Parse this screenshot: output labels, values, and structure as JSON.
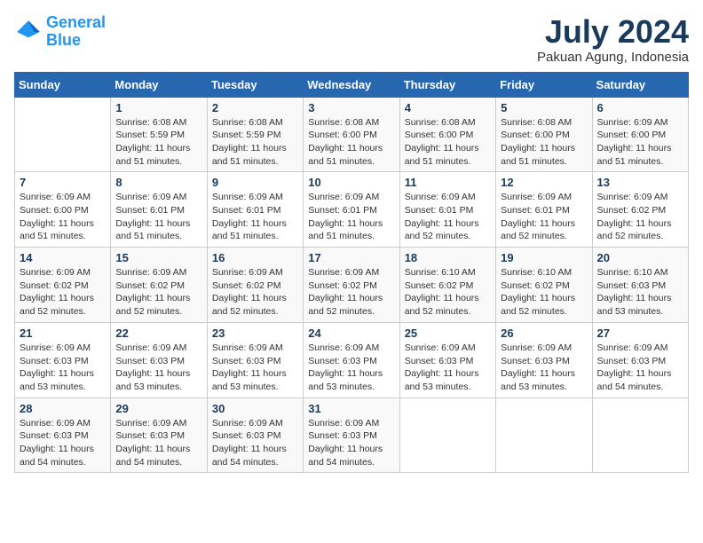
{
  "logo": {
    "text_general": "General",
    "text_blue": "Blue"
  },
  "title": {
    "month_year": "July 2024",
    "location": "Pakuan Agung, Indonesia"
  },
  "weekdays": [
    "Sunday",
    "Monday",
    "Tuesday",
    "Wednesday",
    "Thursday",
    "Friday",
    "Saturday"
  ],
  "days": [
    {
      "date": "",
      "info": ""
    },
    {
      "date": "1",
      "info": "Sunrise: 6:08 AM\nSunset: 5:59 PM\nDaylight: 11 hours\nand 51 minutes."
    },
    {
      "date": "2",
      "info": "Sunrise: 6:08 AM\nSunset: 5:59 PM\nDaylight: 11 hours\nand 51 minutes."
    },
    {
      "date": "3",
      "info": "Sunrise: 6:08 AM\nSunset: 6:00 PM\nDaylight: 11 hours\nand 51 minutes."
    },
    {
      "date": "4",
      "info": "Sunrise: 6:08 AM\nSunset: 6:00 PM\nDaylight: 11 hours\nand 51 minutes."
    },
    {
      "date": "5",
      "info": "Sunrise: 6:08 AM\nSunset: 6:00 PM\nDaylight: 11 hours\nand 51 minutes."
    },
    {
      "date": "6",
      "info": "Sunrise: 6:09 AM\nSunset: 6:00 PM\nDaylight: 11 hours\nand 51 minutes."
    },
    {
      "date": "7",
      "info": "Sunrise: 6:09 AM\nSunset: 6:00 PM\nDaylight: 11 hours\nand 51 minutes."
    },
    {
      "date": "8",
      "info": "Sunrise: 6:09 AM\nSunset: 6:01 PM\nDaylight: 11 hours\nand 51 minutes."
    },
    {
      "date": "9",
      "info": "Sunrise: 6:09 AM\nSunset: 6:01 PM\nDaylight: 11 hours\nand 51 minutes."
    },
    {
      "date": "10",
      "info": "Sunrise: 6:09 AM\nSunset: 6:01 PM\nDaylight: 11 hours\nand 51 minutes."
    },
    {
      "date": "11",
      "info": "Sunrise: 6:09 AM\nSunset: 6:01 PM\nDaylight: 11 hours\nand 52 minutes."
    },
    {
      "date": "12",
      "info": "Sunrise: 6:09 AM\nSunset: 6:01 PM\nDaylight: 11 hours\nand 52 minutes."
    },
    {
      "date": "13",
      "info": "Sunrise: 6:09 AM\nSunset: 6:02 PM\nDaylight: 11 hours\nand 52 minutes."
    },
    {
      "date": "14",
      "info": "Sunrise: 6:09 AM\nSunset: 6:02 PM\nDaylight: 11 hours\nand 52 minutes."
    },
    {
      "date": "15",
      "info": "Sunrise: 6:09 AM\nSunset: 6:02 PM\nDaylight: 11 hours\nand 52 minutes."
    },
    {
      "date": "16",
      "info": "Sunrise: 6:09 AM\nSunset: 6:02 PM\nDaylight: 11 hours\nand 52 minutes."
    },
    {
      "date": "17",
      "info": "Sunrise: 6:09 AM\nSunset: 6:02 PM\nDaylight: 11 hours\nand 52 minutes."
    },
    {
      "date": "18",
      "info": "Sunrise: 6:10 AM\nSunset: 6:02 PM\nDaylight: 11 hours\nand 52 minutes."
    },
    {
      "date": "19",
      "info": "Sunrise: 6:10 AM\nSunset: 6:02 PM\nDaylight: 11 hours\nand 52 minutes."
    },
    {
      "date": "20",
      "info": "Sunrise: 6:10 AM\nSunset: 6:03 PM\nDaylight: 11 hours\nand 53 minutes."
    },
    {
      "date": "21",
      "info": "Sunrise: 6:09 AM\nSunset: 6:03 PM\nDaylight: 11 hours\nand 53 minutes."
    },
    {
      "date": "22",
      "info": "Sunrise: 6:09 AM\nSunset: 6:03 PM\nDaylight: 11 hours\nand 53 minutes."
    },
    {
      "date": "23",
      "info": "Sunrise: 6:09 AM\nSunset: 6:03 PM\nDaylight: 11 hours\nand 53 minutes."
    },
    {
      "date": "24",
      "info": "Sunrise: 6:09 AM\nSunset: 6:03 PM\nDaylight: 11 hours\nand 53 minutes."
    },
    {
      "date": "25",
      "info": "Sunrise: 6:09 AM\nSunset: 6:03 PM\nDaylight: 11 hours\nand 53 minutes."
    },
    {
      "date": "26",
      "info": "Sunrise: 6:09 AM\nSunset: 6:03 PM\nDaylight: 11 hours\nand 53 minutes."
    },
    {
      "date": "27",
      "info": "Sunrise: 6:09 AM\nSunset: 6:03 PM\nDaylight: 11 hours\nand 54 minutes."
    },
    {
      "date": "28",
      "info": "Sunrise: 6:09 AM\nSunset: 6:03 PM\nDaylight: 11 hours\nand 54 minutes."
    },
    {
      "date": "29",
      "info": "Sunrise: 6:09 AM\nSunset: 6:03 PM\nDaylight: 11 hours\nand 54 minutes."
    },
    {
      "date": "30",
      "info": "Sunrise: 6:09 AM\nSunset: 6:03 PM\nDaylight: 11 hours\nand 54 minutes."
    },
    {
      "date": "31",
      "info": "Sunrise: 6:09 AM\nSunset: 6:03 PM\nDaylight: 11 hours\nand 54 minutes."
    },
    {
      "date": "",
      "info": ""
    },
    {
      "date": "",
      "info": ""
    },
    {
      "date": "",
      "info": ""
    }
  ]
}
